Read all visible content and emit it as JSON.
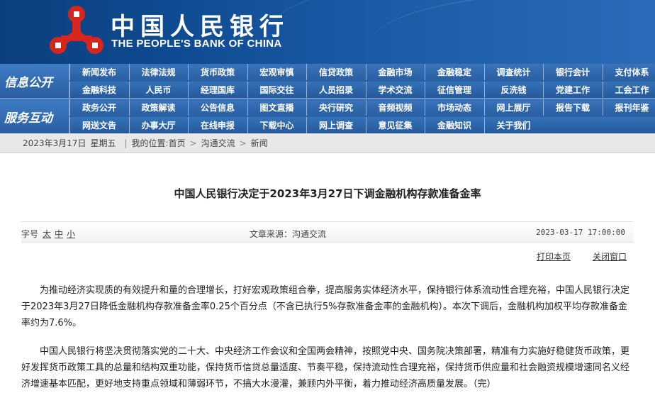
{
  "header": {
    "name_cn": "中国人民银行",
    "name_en": "THE PEOPLE'S BANK OF CHINA",
    "emblem_color": "#d7261e"
  },
  "nav": {
    "sections": [
      {
        "label": "信息公开",
        "rows": [
          [
            "新闻发布",
            "法律法规",
            "货币政策",
            "宏观审慎",
            "信贷政策",
            "金融市场",
            "金融稳定",
            "调查统计",
            "银行会计",
            "支付体系"
          ],
          [
            "金融科技",
            "人民币",
            "经理国库",
            "国际交往",
            "人员招录",
            "学术交流",
            "征信管理",
            "反洗钱",
            "党建工作",
            "工会工作"
          ]
        ]
      },
      {
        "label": "服务互动",
        "rows": [
          [
            "政务公开",
            "政策解读",
            "公告信息",
            "图文直播",
            "央行研究",
            "音频视频",
            "市场动态",
            "网上展厅",
            "报告下载",
            "报刊年鉴"
          ],
          [
            "网送文告",
            "办事大厅",
            "在线申报",
            "下载中心",
            "网上调查",
            "意见征集",
            "金融知识",
            "关于我们"
          ]
        ]
      }
    ]
  },
  "breadcrumb": {
    "date": "2023年3月17日",
    "weekday": "星期五",
    "location_label": "我的位置:",
    "home": "首页",
    "level1": "沟通交流",
    "level2": "新闻",
    "separator": ">"
  },
  "article": {
    "title": "中国人民银行决定于2023年3月27日下调金融机构存款准备金率",
    "font_size_label": "字号",
    "font_sizes": [
      "太",
      "中",
      "小"
    ],
    "source": "文章来源：沟通交流",
    "datetime": "2023-03-17 17:00:00",
    "print_label": "打印本页",
    "close_label": "关闭窗口",
    "paragraphs": [
      "为推动经济实现质的有效提升和量的合理增长，打好宏观政策组合拳，提高服务实体经济水平，保持银行体系流动性合理充裕，中国人民银行决定于2023年3月27日降低金融机构存款准备金率0.25个百分点（不含已执行5%存款准备金率的金融机构）。本次下调后，金融机构加权平均存款准备金率约为7.6%。",
      "中国人民银行将坚决贯彻落实党的二十大、中央经济工作会议和全国两会精神，按照党中央、国务院决策部署，精准有力实施好稳健货币政策，更好发挥货币政策工具的总量和结构双重功能，保持货币信贷总量适度、节奏平稳，保持流动性合理充裕，保持货币供应量和社会融资规模增速同名义经济增速基本匹配，更好地支持重点领域和薄弱环节，不搞大水漫灌，兼顾内外平衡，着力推动经济高质量发展。（完）"
    ]
  }
}
